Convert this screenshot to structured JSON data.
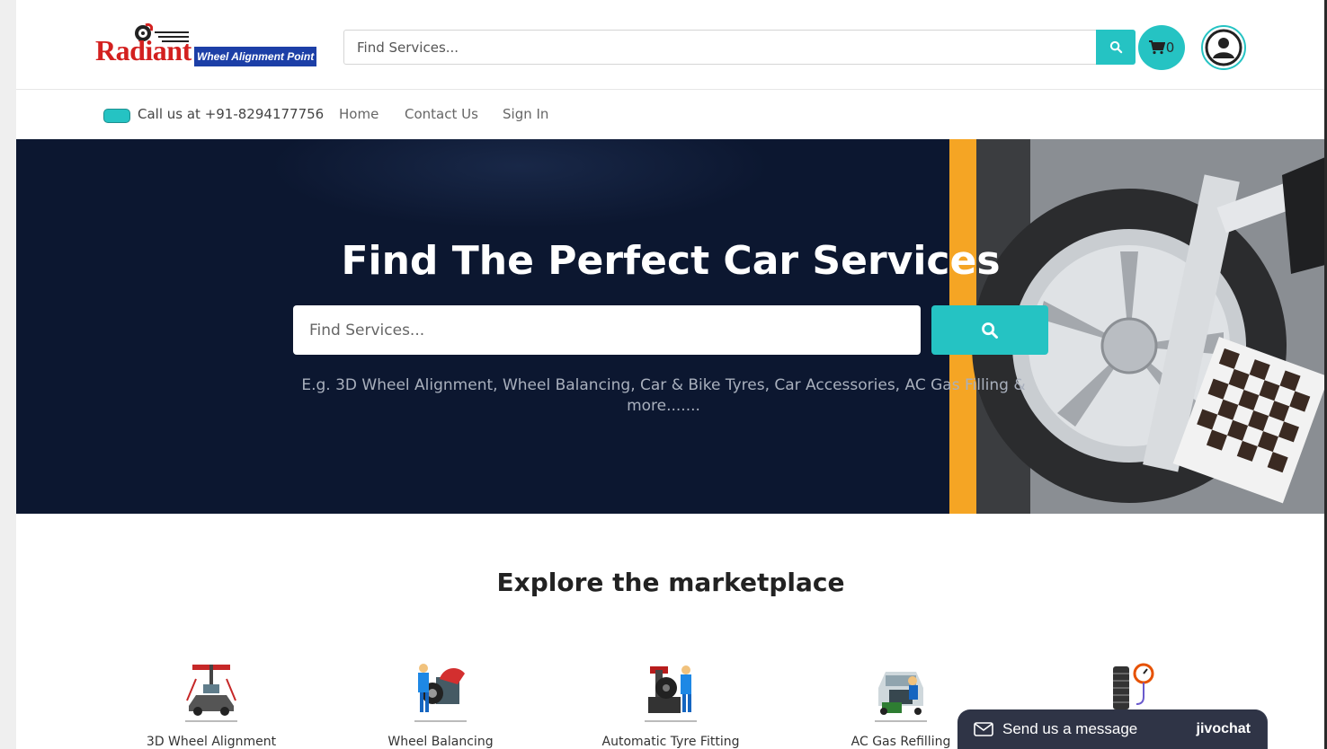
{
  "header": {
    "logo_word": "Radiant",
    "logo_tagline": "Wheel Alignment Point",
    "search_placeholder": "Find Services...",
    "cart_count": "0"
  },
  "nav": {
    "phone": "Call us at +91-8294177756",
    "items": [
      "Home",
      "Contact Us",
      "Sign In"
    ]
  },
  "hero": {
    "title": "Find The Perfect Car Services",
    "search_placeholder": "Find Services...",
    "hint": "E.g. 3D Wheel Alignment, Wheel Balancing, Car & Bike Tyres, Car Accessories, AC Gas Filling & more......."
  },
  "explore": {
    "title": "Explore the marketplace",
    "services": [
      {
        "label": "3D Wheel Alignment",
        "icon": "wheel-alignment-icon"
      },
      {
        "label": "Wheel Balancing",
        "icon": "wheel-balancing-icon"
      },
      {
        "label": "Automatic Tyre Fitting",
        "icon": "tyre-fitting-icon"
      },
      {
        "label": "AC Gas Refilling",
        "icon": "ac-gas-icon"
      },
      {
        "label": "",
        "icon": "tyre-pressure-icon"
      }
    ]
  },
  "chat": {
    "message": "Send us a message",
    "brand": "jivochat"
  },
  "colors": {
    "accent": "#25c3c3",
    "hero_bg": "#0c1730",
    "logo_red": "#d3201f",
    "logo_blue": "#1c3fa7",
    "chat_bg": "#2f3446"
  }
}
